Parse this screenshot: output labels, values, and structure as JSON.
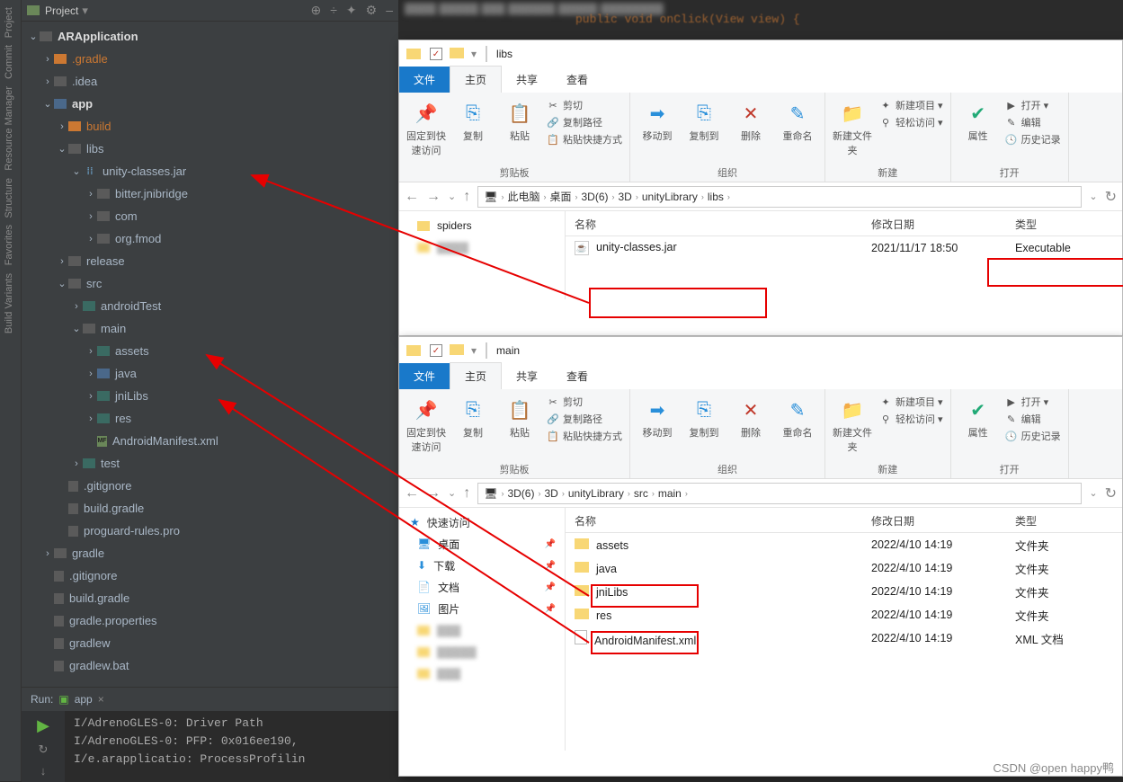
{
  "ide": {
    "sidebar_labels": [
      "Project",
      "Commit",
      "Resource Manager",
      "Structure",
      "Favorites",
      "Build Variants"
    ],
    "topbar": {
      "title": "Project",
      "dropdown": "▾",
      "actions": [
        "⊕",
        "÷",
        "✦",
        "⚙",
        "–"
      ]
    },
    "tree": [
      {
        "ind": 6,
        "arrow": "v",
        "icon": "folder",
        "cls": "bold",
        "label": "ARApplication"
      },
      {
        "ind": 22,
        "arrow": ">",
        "icon": "folder orange",
        "cls": "orange",
        "label": ".gradle"
      },
      {
        "ind": 22,
        "arrow": ">",
        "icon": "folder",
        "label": ".idea"
      },
      {
        "ind": 22,
        "arrow": "v",
        "icon": "folder blueish",
        "cls": "bold",
        "label": "app"
      },
      {
        "ind": 38,
        "arrow": ">",
        "icon": "folder orange",
        "cls": "orange",
        "label": "build"
      },
      {
        "ind": 38,
        "arrow": "v",
        "icon": "folder",
        "label": "libs"
      },
      {
        "ind": 54,
        "arrow": "v",
        "icon": "jar",
        "label": "unity-classes.jar"
      },
      {
        "ind": 70,
        "arrow": ">",
        "icon": "folder",
        "label": "bitter.jnibridge"
      },
      {
        "ind": 70,
        "arrow": ">",
        "icon": "folder",
        "label": "com"
      },
      {
        "ind": 70,
        "arrow": ">",
        "icon": "folder",
        "label": "org.fmod"
      },
      {
        "ind": 38,
        "arrow": ">",
        "icon": "folder",
        "label": "release"
      },
      {
        "ind": 38,
        "arrow": "v",
        "icon": "folder",
        "label": "src"
      },
      {
        "ind": 54,
        "arrow": ">",
        "icon": "folder teal",
        "label": "androidTest"
      },
      {
        "ind": 54,
        "arrow": "v",
        "icon": "folder",
        "label": "main"
      },
      {
        "ind": 70,
        "arrow": ">",
        "icon": "folder teal",
        "label": "assets"
      },
      {
        "ind": 70,
        "arrow": ">",
        "icon": "folder blueish",
        "label": "java"
      },
      {
        "ind": 70,
        "arrow": ">",
        "icon": "folder teal",
        "label": "jniLibs"
      },
      {
        "ind": 70,
        "arrow": ">",
        "icon": "folder teal",
        "label": "res"
      },
      {
        "ind": 70,
        "arrow": "",
        "icon": "file mf",
        "label": "AndroidManifest.xml"
      },
      {
        "ind": 54,
        "arrow": ">",
        "icon": "folder teal",
        "label": "test"
      },
      {
        "ind": 38,
        "arrow": "",
        "icon": "file",
        "label": ".gitignore"
      },
      {
        "ind": 38,
        "arrow": "",
        "icon": "file",
        "label": "build.gradle"
      },
      {
        "ind": 38,
        "arrow": "",
        "icon": "file",
        "label": "proguard-rules.pro"
      },
      {
        "ind": 22,
        "arrow": ">",
        "icon": "folder",
        "label": "gradle"
      },
      {
        "ind": 22,
        "arrow": "",
        "icon": "file",
        "label": ".gitignore"
      },
      {
        "ind": 22,
        "arrow": "",
        "icon": "file",
        "label": "build.gradle"
      },
      {
        "ind": 22,
        "arrow": "",
        "icon": "file",
        "label": "gradle.properties"
      },
      {
        "ind": 22,
        "arrow": "",
        "icon": "file",
        "label": "gradlew"
      },
      {
        "ind": 22,
        "arrow": "",
        "icon": "file",
        "label": "gradlew.bat"
      }
    ],
    "run": {
      "tab_label": "Run:",
      "config": "app",
      "log": "I/AdrenoGLES-0: Driver Path\nI/AdrenoGLES-0: PFP: 0x016ee190,\nI/e.arapplicatio: ProcessProfilin"
    }
  },
  "code_hint": "public void onClick(View view) {",
  "explorer_top": {
    "title": "libs",
    "tabs": {
      "file": "文件",
      "home": "主页",
      "share": "共享",
      "view": "查看"
    },
    "ribbon": {
      "pin": "固定到快速访问",
      "copy": "复制",
      "paste": "粘贴",
      "cut": "剪切",
      "copypath": "复制路径",
      "paste_shortcut": "粘贴快捷方式",
      "clipboard": "剪贴板",
      "moveto": "移动到",
      "copyto": "复制到",
      "delete": "删除",
      "rename": "重命名",
      "organize": "组织",
      "newfolder": "新建文件夹",
      "newitem": "新建项目",
      "easyaccess": "轻松访问",
      "new": "新建",
      "properties": "属性",
      "open": "打开",
      "edit": "编辑",
      "history": "历史记录",
      "open_group": "打开"
    },
    "path": [
      "此电脑",
      "桌面",
      "3D(6)",
      "3D",
      "unityLibrary",
      "libs"
    ],
    "cols": {
      "name": "名称",
      "date": "修改日期",
      "type": "类型"
    },
    "nav": [
      {
        "label": "spiders",
        "fld": true
      }
    ],
    "rows": [
      {
        "kind": "jar",
        "name": "unity-classes.jar",
        "date": "2021/11/17 18:50",
        "type": "Executable"
      }
    ]
  },
  "explorer_bottom": {
    "title": "main",
    "tabs": {
      "file": "文件",
      "home": "主页",
      "share": "共享",
      "view": "查看"
    },
    "ribbon_reuse": true,
    "path": [
      "3D(6)",
      "3D",
      "unityLibrary",
      "src",
      "main"
    ],
    "cols": {
      "name": "名称",
      "date": "修改日期",
      "type": "类型"
    },
    "nav": {
      "quick": "快速访问",
      "desktop": "桌面",
      "downloads": "下载",
      "documents": "文档",
      "pictures": "图片"
    },
    "rows": [
      {
        "kind": "folder",
        "name": "assets",
        "date": "2022/4/10 14:19",
        "type": "文件夹"
      },
      {
        "kind": "folder",
        "name": "java",
        "date": "2022/4/10 14:19",
        "type": "文件夹"
      },
      {
        "kind": "folder",
        "name": "jniLibs",
        "date": "2022/4/10 14:19",
        "type": "文件夹"
      },
      {
        "kind": "folder",
        "name": "res",
        "date": "2022/4/10 14:19",
        "type": "文件夹"
      },
      {
        "kind": "file",
        "name": "AndroidManifest.xml",
        "date": "2022/4/10 14:19",
        "type": "XML 文档"
      }
    ]
  },
  "watermark": "CSDN @open happy鸭"
}
